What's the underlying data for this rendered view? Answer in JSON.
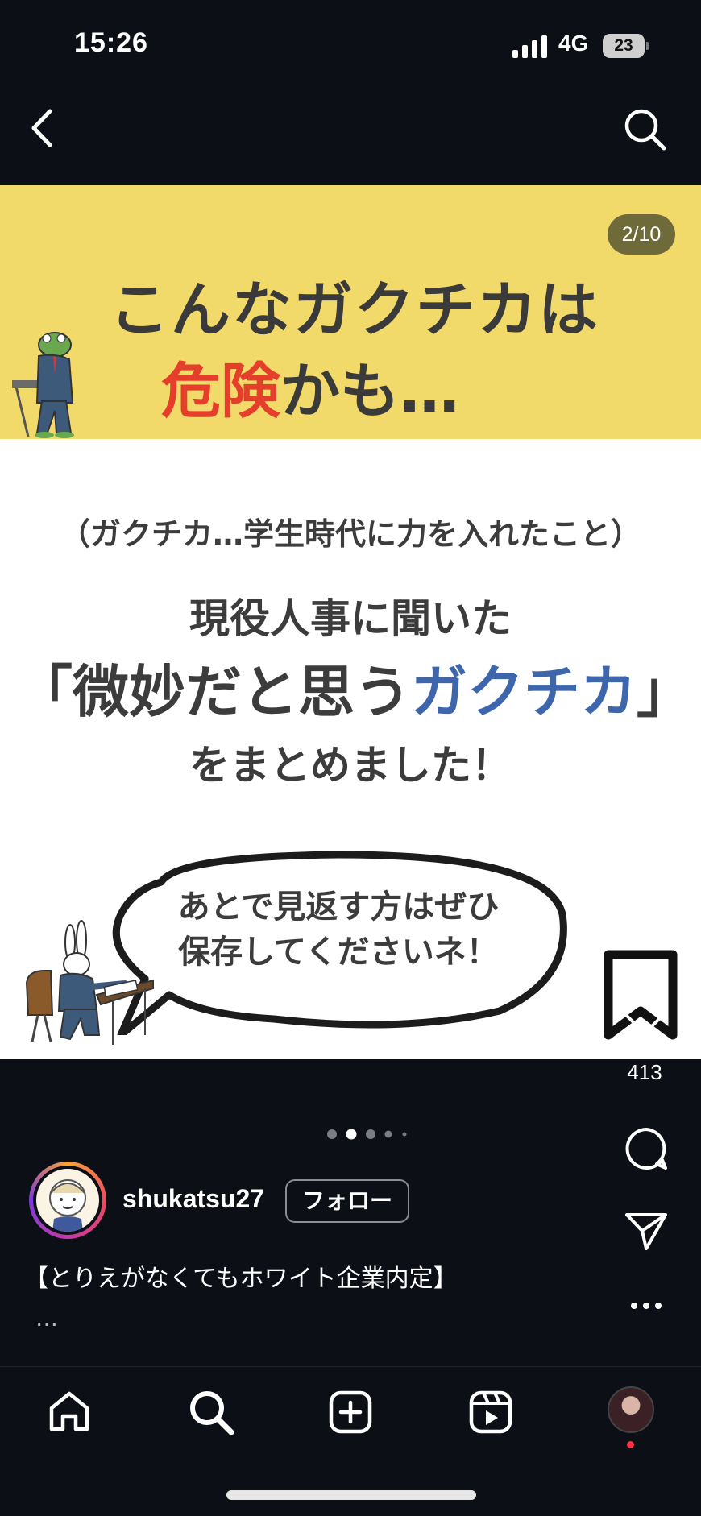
{
  "status_bar": {
    "time": "15:26",
    "network": "4G",
    "battery": "23"
  },
  "post": {
    "counter": "2/10",
    "headline_line1": "こんなガクチカは",
    "headline_line2_red": "危険",
    "headline_line2_rest": "かも…",
    "sub_paren": "（ガクチカ…学生時代に力を入れたこと）",
    "sub_line2": "現役人事に聞いた",
    "sub_line3_open": "「微妙だと思う",
    "sub_line3_blue": "ガクチカ",
    "sub_line3_close": "」",
    "sub_line4": "をまとめました！",
    "bubble_line1": "あとで見返す方はぜひ",
    "bubble_line2": "保存してくださいネ！"
  },
  "actions": {
    "like_count": "413"
  },
  "carousel": {
    "total_dots": 5,
    "active_index": 1
  },
  "author": {
    "username": "shukatsu27",
    "follow_label": "フォロー"
  },
  "caption": {
    "text": "【とりえがなくてもホワイト企業内定】",
    "more": "…"
  },
  "colors": {
    "background": "#0c0f16",
    "banner": "#f2da6a",
    "danger_red": "#e53f2b",
    "accent_blue": "#3d66ad",
    "notification_red": "#ff3040"
  },
  "icons": [
    "back-icon",
    "search-icon",
    "bookmark-icon",
    "heart-icon",
    "comment-icon",
    "share-icon",
    "more-icon",
    "home-icon",
    "create-icon",
    "reels-icon"
  ]
}
